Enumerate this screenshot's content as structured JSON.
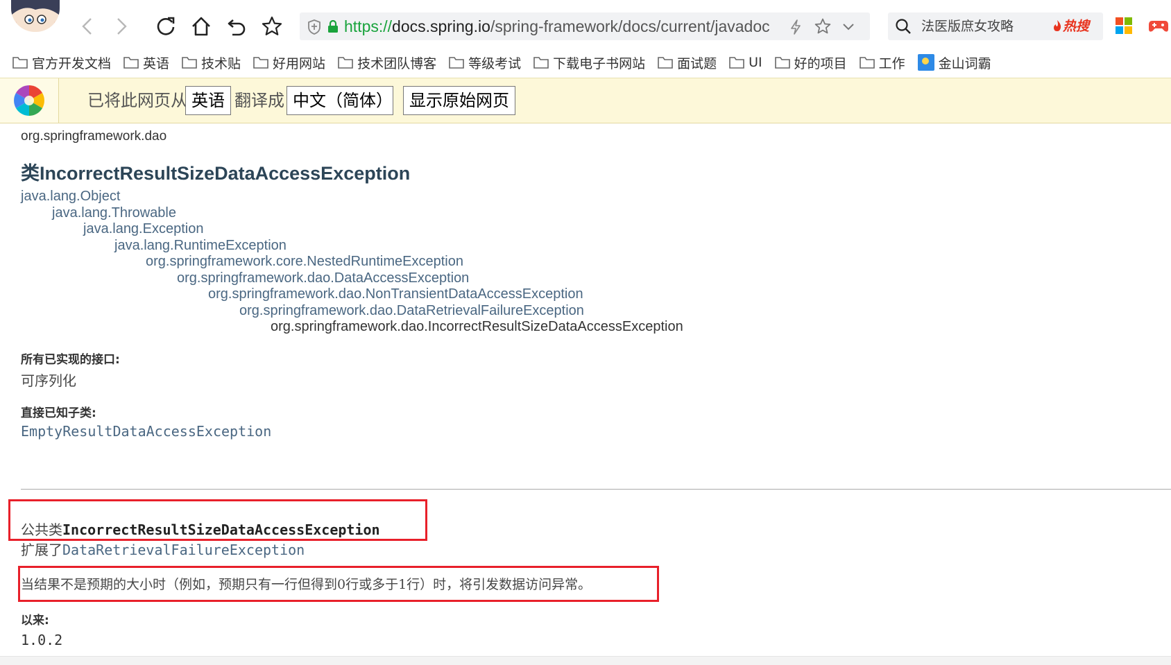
{
  "browser": {
    "url_scheme": "https://",
    "url_host": "docs.spring.io",
    "url_path": "/spring-framework/docs/current/javadoc",
    "search_text": "法医版庶女攻略",
    "hot_label": "热搜"
  },
  "bookmarks": [
    {
      "label": "官方开发文档",
      "icon": "folder-icon"
    },
    {
      "label": "英语",
      "icon": "folder-icon"
    },
    {
      "label": "技术贴",
      "icon": "folder-icon"
    },
    {
      "label": "好用网站",
      "icon": "folder-icon"
    },
    {
      "label": "技术团队博客",
      "icon": "folder-icon"
    },
    {
      "label": "等级考试",
      "icon": "folder-icon"
    },
    {
      "label": "下载电子书网站",
      "icon": "folder-icon"
    },
    {
      "label": "面试题",
      "icon": "folder-icon"
    },
    {
      "label": "UI",
      "icon": "folder-icon"
    },
    {
      "label": "好的项目",
      "icon": "folder-icon"
    },
    {
      "label": "工作",
      "icon": "folder-icon"
    },
    {
      "label": "金山词霸",
      "icon": "kingsoft-icon"
    }
  ],
  "translate_bar": {
    "text_before": "已将此网页从",
    "from_language": "英语",
    "text_middle": "翻译成",
    "to_language": "中文（简体）",
    "show_original": "显示原始网页"
  },
  "page": {
    "package": "org.springframework.dao",
    "class_title": "类IncorrectResultSizeDataAccessException",
    "inheritance": [
      "java.lang.Object",
      "java.lang.Throwable",
      "java.lang.Exception",
      "java.lang.RuntimeException",
      "org.springframework.core.NestedRuntimeException",
      "org.springframework.dao.DataAccessException",
      "org.springframework.dao.NonTransientDataAccessException",
      "org.springframework.dao.DataRetrievalFailureException",
      "org.springframework.dao.IncorrectResultSizeDataAccessException"
    ],
    "interfaces_label": "所有已实现的接口:",
    "interfaces_value": "可序列化",
    "subclasses_label": "直接已知子类:",
    "subclass_link": "EmptyResultDataAccessException",
    "signature_modifier": "公共类",
    "signature_name": "IncorrectResultSizeDataAccessException",
    "extends_keyword": "扩展了",
    "extends_link": "DataRetrievalFailureException",
    "description": "当结果不是预期的大小时（例如，预期只有一行但得到0行或多于1行）时，将引发数据访问异常。",
    "since_label": "以来:",
    "since_value": "1.0.2"
  }
}
